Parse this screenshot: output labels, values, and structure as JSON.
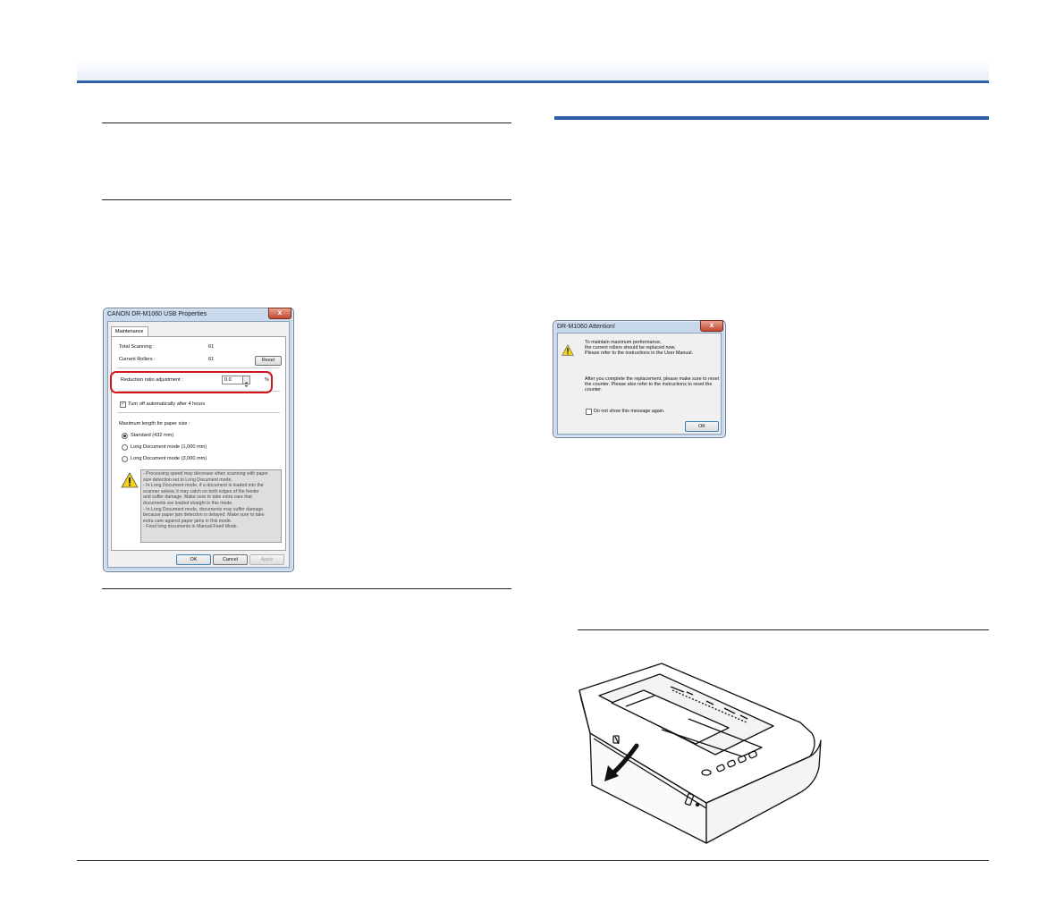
{
  "properties_dialog": {
    "title": "CANON DR-M1060 USB Properties",
    "close_glyph": "x",
    "tab": "Maintenance",
    "total_scanning_label": "Total Scanning :",
    "total_scanning_value": "61",
    "current_rollers_label": "Current Rollers :",
    "current_rollers_value": "61",
    "reset_button": "Reset",
    "reduction_label": "Reduction ratio adjustment :",
    "reduction_value": "0.0",
    "reduction_unit": "%",
    "auto_off_label": "Turn off automatically after 4 hours",
    "auto_off_checked": true,
    "max_length_label": "Maximum length for paper size :",
    "options": [
      {
        "label": "Standard (432 mm)",
        "selected": true
      },
      {
        "label": "Long Document mode (1,000 mm)",
        "selected": false
      },
      {
        "label": "Long Document mode (3,000 mm)",
        "selected": false
      }
    ],
    "info_lines": [
      "- Processing speed may decrease when scanning with paper",
      "size detection set to Long Document mode.",
      "- In Long Document mode, if a document is loaded into the",
      "scanner askew, it may catch on both edges of the feeder",
      "and suffer damage. Make sure to take extra care that",
      "documents are loaded straight in this mode.",
      "- In Long Document mode, documents may suffer damage",
      "because paper jam detection is delayed. Make sure to take",
      "extra care against paper jams in this mode.",
      "- Feed long documents in Manual Feed Mode."
    ],
    "ok_button": "OK",
    "cancel_button": "Cancel",
    "apply_button": "Apply"
  },
  "attention_dialog": {
    "title": "DR-M1060 Attention!",
    "close_glyph": "x",
    "line1": "To maintain maximum performance,",
    "line2": "the current rollers should be replaced now.",
    "line3": "Please refer to the instructions in the User Manual.",
    "line4": "After you complete the replacement, please make sure to reset",
    "line5": "the counter. Please also refer to the instructions to reset the",
    "line6": "counter.",
    "checkbox_label": "Do not show this message again.",
    "ok_button": "OK"
  },
  "colors": {
    "header_rule": "#2e62a6",
    "section_rule": "#2a5ea6",
    "highlight": "#d4141b"
  }
}
